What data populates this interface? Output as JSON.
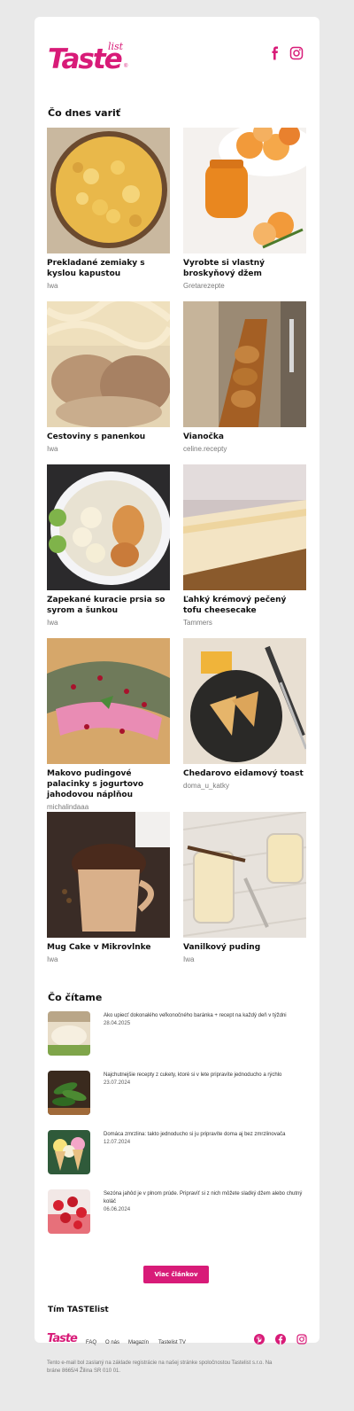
{
  "brand": {
    "logo_main": "Taste",
    "logo_small": "list",
    "logo_reg": "®",
    "accent": "#d81b78"
  },
  "header": {
    "icons": [
      "facebook-icon",
      "instagram-icon"
    ]
  },
  "today": {
    "title": "Čo dnes variť",
    "recipes": [
      {
        "title": "Prekladané zemiaky s kyslou kapustou",
        "author": "Iwa"
      },
      {
        "title": "Vyrobte si vlastný broskyňový džem",
        "author": "Gretarezepte"
      },
      {
        "title": "Cestoviny s panenkou",
        "author": "Iwa"
      },
      {
        "title": "Vianočka",
        "author": "celine.recepty"
      },
      {
        "title": "Zapekané kuracie prsia so syrom a šunkou",
        "author": "Iwa"
      },
      {
        "title": "Ľahký krémový pečený tofu cheesecake",
        "author": "Tammers"
      },
      {
        "title": "Makovo pudingové palacinky s jogurtovo jahodovou náplňou",
        "author": "michalindaaa"
      },
      {
        "title": "Chedarovo eidamový toast",
        "author": "doma_u_katky"
      },
      {
        "title": "Mug Cake v Mikrovlnke",
        "author": "Iwa"
      },
      {
        "title": "Vanilkový puding",
        "author": "Iwa"
      }
    ]
  },
  "reading": {
    "title": "Čo čítame",
    "articles": [
      {
        "title": "Ako upiecť dokonalého veľkonočného baránka + recept na každý deň v týždni",
        "date": "28.04.2025"
      },
      {
        "title": "Najchutnejšie recepty z cukety, ktoré si v lete pripravíte jednoducho a rýchlo",
        "date": "23.07.2024"
      },
      {
        "title": "Domáca zmrzlina: takto jednoducho si ju pripravíte doma aj bez zmrzlinovača",
        "date": "12.07.2024"
      },
      {
        "title": "Sezóna jahôd je v plnom prúde. Pripravíť si z nich môžete sladký džem alebo chutný koláč",
        "date": "06.06.2024"
      }
    ],
    "more_label": "Viac článkov"
  },
  "signoff": "Tím TASTElist",
  "footer": {
    "logo": "Taste",
    "links": [
      "FAQ",
      "O nás",
      "Magazín",
      "Tastelist TV"
    ],
    "icons": [
      "pinterest-icon",
      "facebook-icon",
      "instagram-icon"
    ],
    "legal": "Tento e-mail bol zaslaný na základe registrácie na našej stránke spoločnostou Tastelist s.r.o. Na bráne 8665/4 Žilina SR 010 01."
  }
}
